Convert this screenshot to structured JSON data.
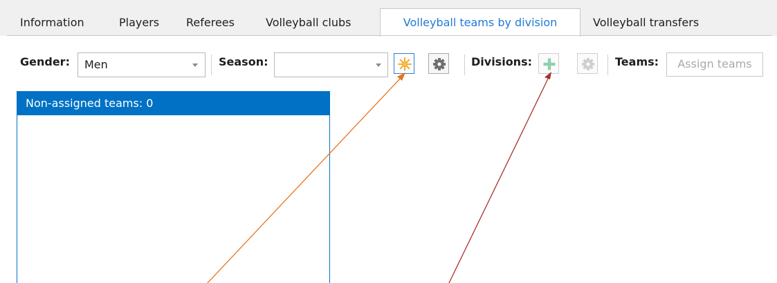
{
  "tabs": [
    {
      "label": "Information",
      "active": false
    },
    {
      "label": "Players",
      "active": false
    },
    {
      "label": "Referees",
      "active": false
    },
    {
      "label": "Volleyball clubs",
      "active": false
    },
    {
      "label": "Volleyball teams by division",
      "active": true
    },
    {
      "label": "Volleyball transfers",
      "active": false
    }
  ],
  "toolbar": {
    "gender_label": "Gender:",
    "gender_value": "Men",
    "season_label": "Season:",
    "season_value": "",
    "divisions_label": "Divisions:",
    "teams_label": "Teams:",
    "assign_teams_label": "Assign teams",
    "new_season_icon": "sparkle-icon",
    "season_settings_icon": "gear-icon",
    "add_division_icon": "plus-icon",
    "division_settings_icon": "gear-icon"
  },
  "panel": {
    "header": "Non-assigned teams: 0",
    "items": []
  },
  "colors": {
    "accent": "#0071c5",
    "active_tab_text": "#1f7bd4",
    "arrow_orange": "#e8731f",
    "arrow_red": "#a8302e",
    "sparkle": "#f0a020",
    "plus_disabled": "#8fcfb0"
  }
}
